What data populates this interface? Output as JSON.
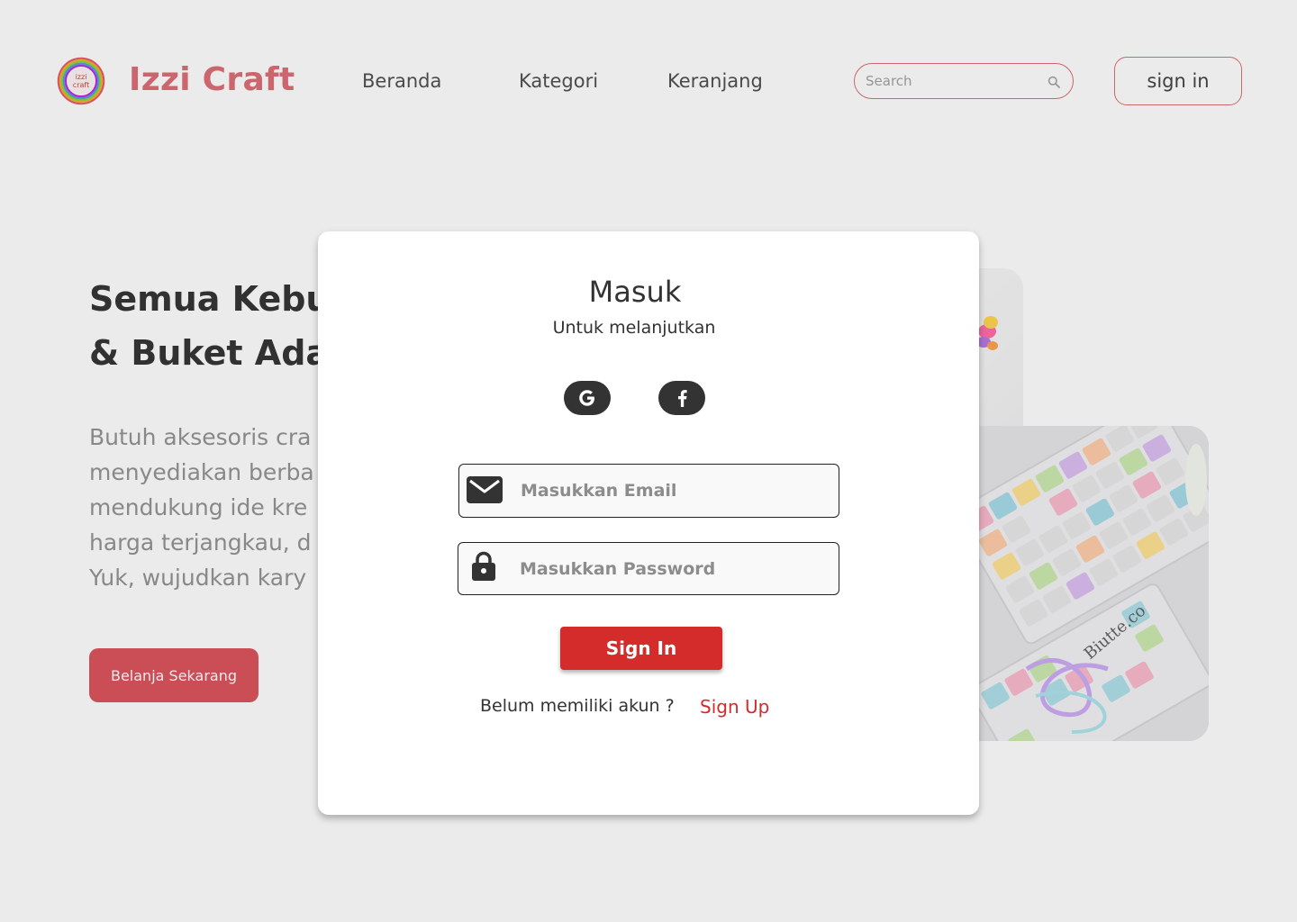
{
  "header": {
    "logo_text": "izzi craft",
    "brand": "Izzi Craft",
    "nav": [
      {
        "label": "Beranda"
      },
      {
        "label": "Kategori"
      },
      {
        "label": "Keranjang"
      }
    ],
    "search": {
      "placeholder": "Search",
      "value": ""
    },
    "signin_label": "sign in"
  },
  "hero": {
    "title_lines": [
      "Semua Kebu",
      "& Buket Ada"
    ],
    "description_lines": [
      "Butuh aksesoris cra",
      "menyediakan berba",
      "mendukung ide kre",
      "harga terjangkau, d",
      "Yuk, wujudkan kary"
    ],
    "cta_label": "Belanja Sekarang",
    "photo_label": "Biutte.co"
  },
  "modal": {
    "title": "Masuk",
    "subtitle": "Untuk melanjutkan",
    "social": [
      {
        "icon": "google-icon"
      },
      {
        "icon": "facebook-icon"
      }
    ],
    "email": {
      "placeholder": "Masukkan Email",
      "value": "",
      "icon": "mail-icon"
    },
    "password": {
      "placeholder": "Masukkan Password",
      "value": "",
      "icon": "lock-icon"
    },
    "submit_label": "Sign In",
    "prompt": "Belum memiliki akun ?",
    "signup_label": "Sign Up"
  },
  "colors": {
    "brand": "#d9606a",
    "primary_red": "#d42b2b",
    "dark": "#333333",
    "overlay": "rgba(128,128,128,0.16)"
  }
}
